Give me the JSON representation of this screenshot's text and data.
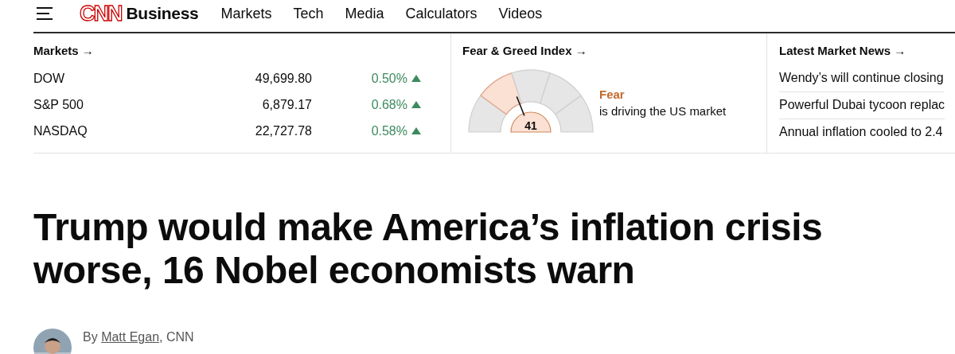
{
  "nav": {
    "logo": "CNN",
    "section": "Business",
    "links": [
      "Markets",
      "Tech",
      "Media",
      "Calculators",
      "Videos"
    ]
  },
  "markets": {
    "heading": "Markets →",
    "rows": [
      {
        "name": "DOW",
        "value": "49,699.80",
        "change": "0.50%",
        "up": true
      },
      {
        "name": "S&P 500",
        "value": "6,879.17",
        "change": "0.68%",
        "up": true
      },
      {
        "name": "NASDAQ",
        "value": "22,727.78",
        "change": "0.58%",
        "up": true
      }
    ]
  },
  "fear_greed": {
    "heading": "Fear & Greed Index →",
    "reading": "41",
    "mood": "Fear",
    "caption": "is driving the US market"
  },
  "news": {
    "heading": "Latest Market News →",
    "items": [
      "Wendy’s will continue closing",
      "Powerful Dubai tycoon replac",
      "Annual inflation cooled to 2.4"
    ]
  },
  "article": {
    "headline": "Trump would make America’s inflation crisis worse, 16 Nobel economists warn",
    "byline_prefix": "By ",
    "author": "Matt Egan",
    "byline_suffix": ", CNN"
  }
}
